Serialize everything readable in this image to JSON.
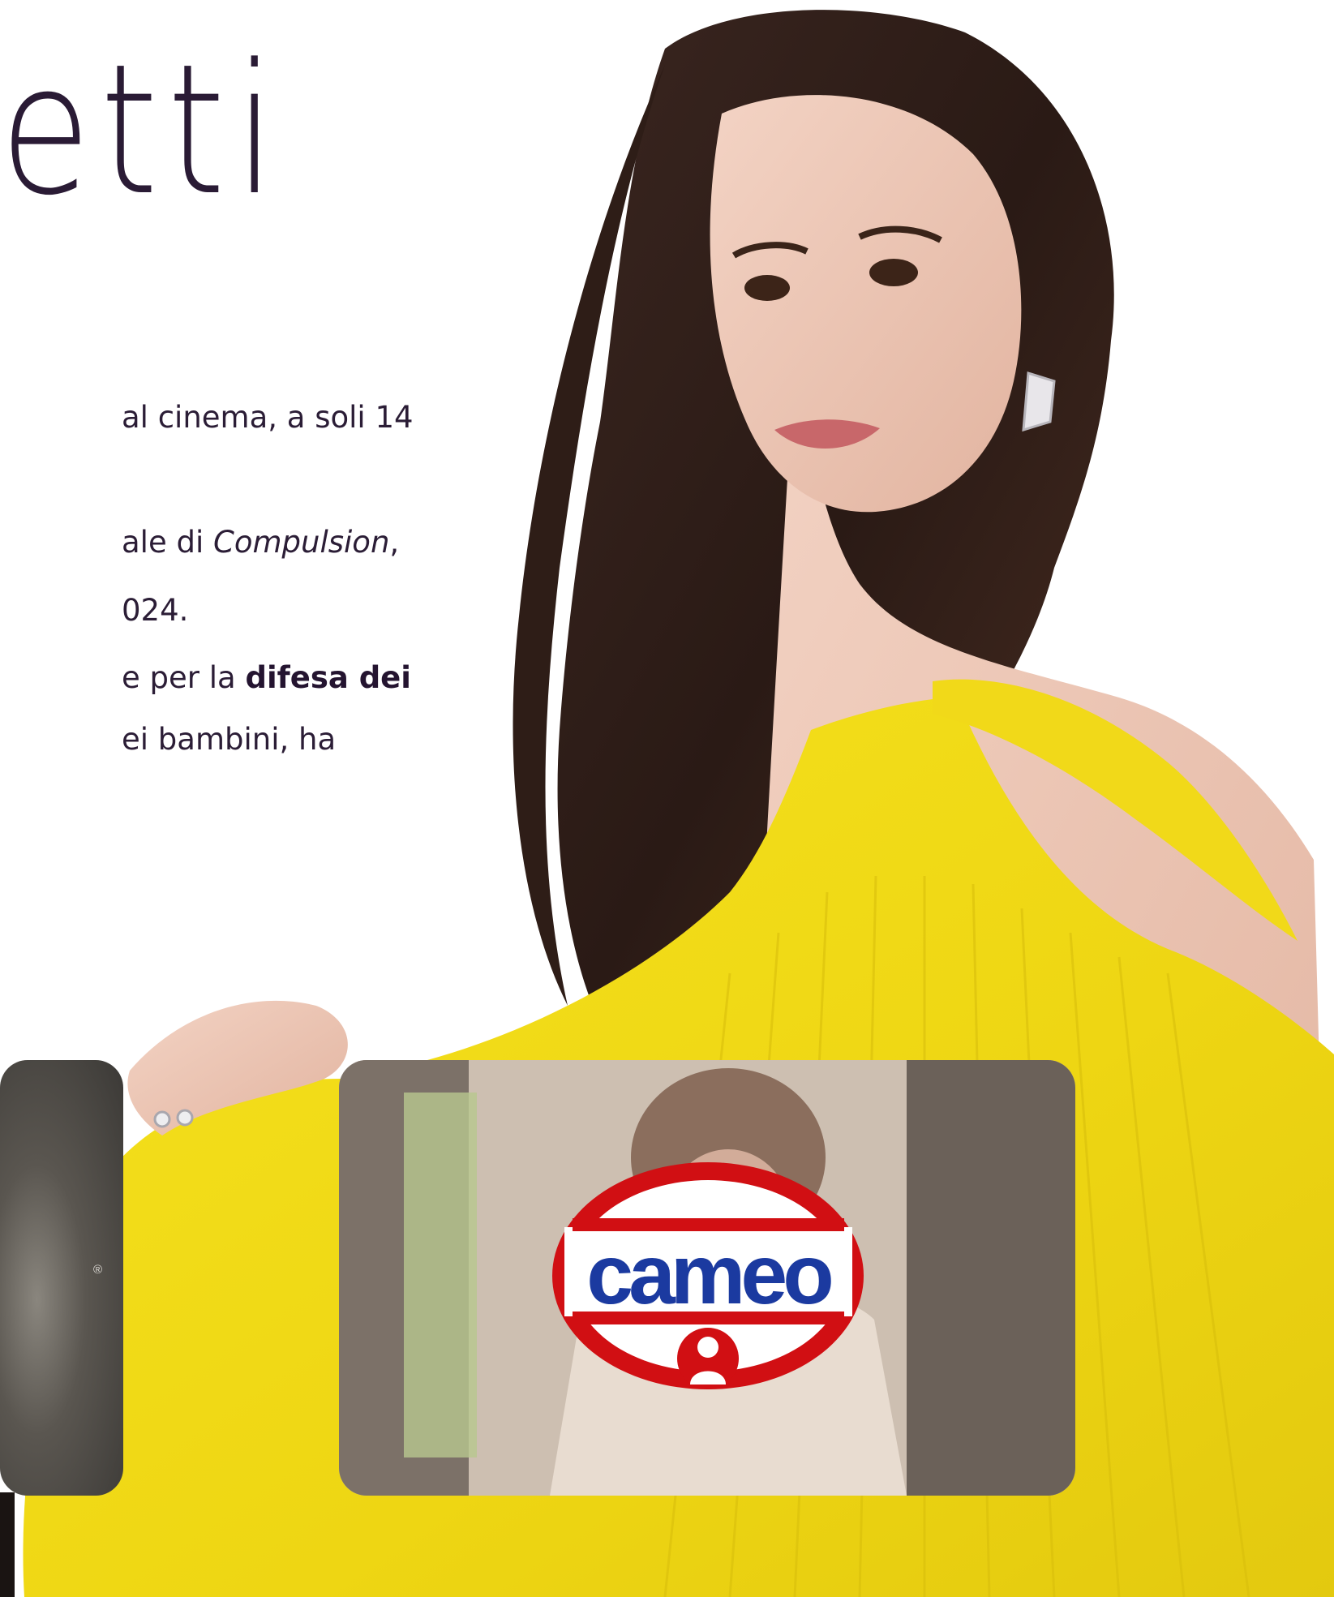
{
  "hero": {
    "title_fragment": "etti"
  },
  "bio": {
    "line1": "al cinema, a soli 14",
    "line2_prefix": "ale di ",
    "line2_italic": "Compulsion",
    "line2_suffix": ",",
    "line3": "024.",
    "line4_prefix": "e per la ",
    "line4_bold": "difesa dei",
    "line5": "ei bambini, ha"
  },
  "cards": {
    "left": {
      "registered_mark": "®"
    },
    "right": {
      "brand_logo_text": "cameo"
    }
  },
  "colors": {
    "text": "#2b1d36",
    "dress_yellow": "#f4dd1a",
    "cameo_red": "#d10f13",
    "cameo_blue": "#1b3aa0"
  },
  "icons": [
    "cameo-logo-icon"
  ]
}
